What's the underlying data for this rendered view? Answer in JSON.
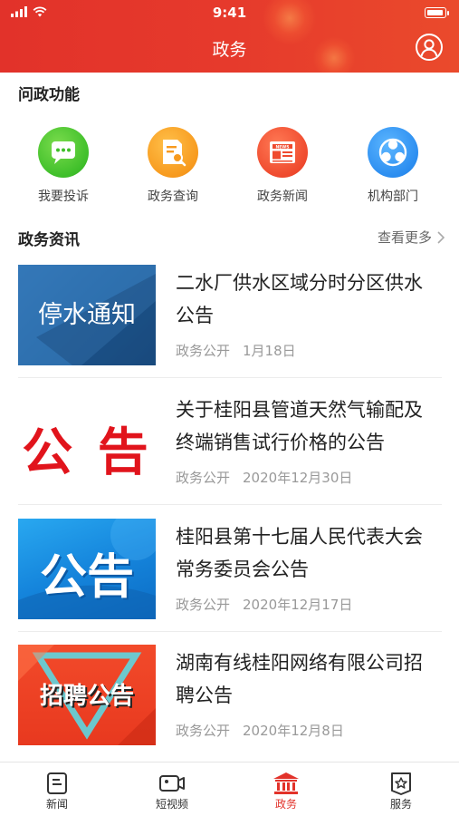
{
  "status": {
    "time": "9:41"
  },
  "header": {
    "title": "政务"
  },
  "functions": {
    "title": "问政功能",
    "items": [
      {
        "label": "我要投诉",
        "icon": "chat-bubble-icon",
        "color": "#3fbf2a"
      },
      {
        "label": "政务查询",
        "icon": "document-search-icon",
        "color": "#f79a1e"
      },
      {
        "label": "政务新闻",
        "icon": "news-icon",
        "color": "#ef4a2e"
      },
      {
        "label": "机构部门",
        "icon": "organization-icon",
        "color": "#2b8df0"
      }
    ]
  },
  "news": {
    "title": "政务资讯",
    "more": "查看更多",
    "items": [
      {
        "title": "二水厂供水区域分时分区供水公告",
        "source": "政务公开",
        "date": "1月18日",
        "thumb_text": "停水通知"
      },
      {
        "title": "关于桂阳县管道天然气输配及终端销售试行价格的公告",
        "source": "政务公开",
        "date": "2020年12月30日",
        "thumb_text": "公 告"
      },
      {
        "title": "桂阳县第十七届人民代表大会常务委员会公告",
        "source": "政务公开",
        "date": "2020年12月17日",
        "thumb_text": "公告"
      },
      {
        "title": "湖南有线桂阳网络有限公司招聘公告",
        "source": "政务公开",
        "date": "2020年12月8日",
        "thumb_text": "招聘公告"
      }
    ]
  },
  "tabbar": {
    "items": [
      {
        "label": "新闻",
        "icon": "news-doc-icon"
      },
      {
        "label": "短视频",
        "icon": "video-camera-icon"
      },
      {
        "label": "政务",
        "icon": "government-building-icon",
        "active": true
      },
      {
        "label": "服务",
        "icon": "service-star-icon"
      }
    ],
    "accent": "#e2322a"
  }
}
